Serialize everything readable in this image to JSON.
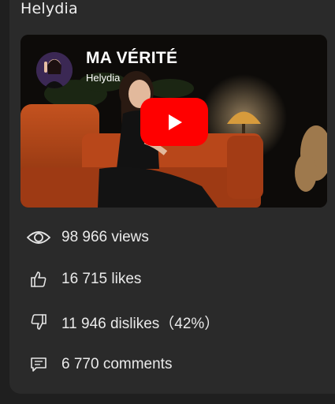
{
  "channel_name": "Helydia",
  "video": {
    "title": "MA VÉRITÉ",
    "channel": "Helydia",
    "play_color": "#ff0000"
  },
  "stats": {
    "views": "98 966 views",
    "likes": "16 715 likes",
    "dislikes": "11 946 dislikes（42%）",
    "comments": "6 770 comments"
  },
  "icons": {
    "views": "eye-icon",
    "likes": "thumbs-up-icon",
    "dislikes": "thumbs-down-icon",
    "comments": "comment-icon"
  }
}
